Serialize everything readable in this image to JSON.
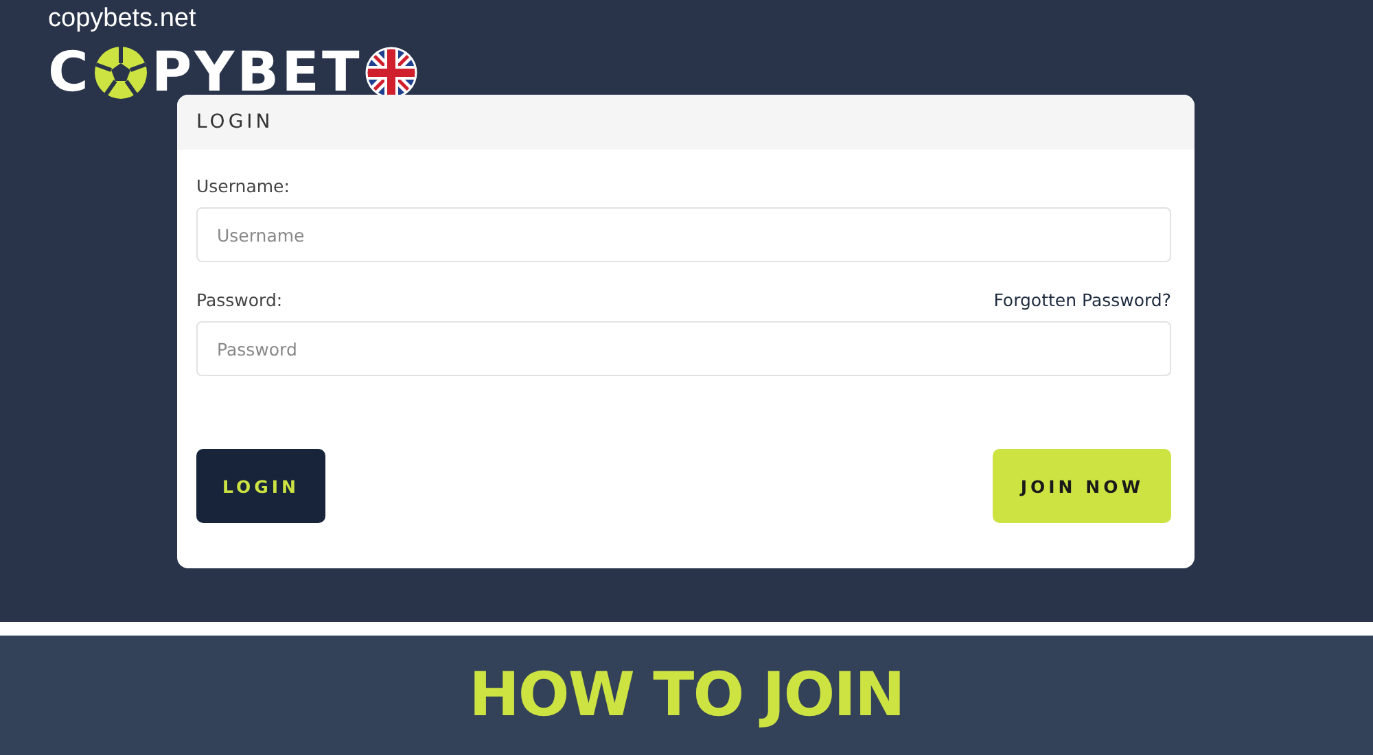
{
  "site": {
    "domain": "copybets.net",
    "logo_start": "C",
    "logo_end": "PYBET"
  },
  "login_form": {
    "title": "LOGIN",
    "fields": [
      {
        "label": "Username:",
        "placeholder": "Username"
      },
      {
        "label": "Password:",
        "placeholder": "Password",
        "link": "Forgotten Password?"
      }
    ],
    "buttons": [
      {
        "kind": "dark",
        "label": "LOGIN"
      },
      {
        "kind": "accent",
        "label": "JOIN NOW"
      }
    ]
  },
  "banner": {
    "title": "HOW TO JOIN"
  }
}
